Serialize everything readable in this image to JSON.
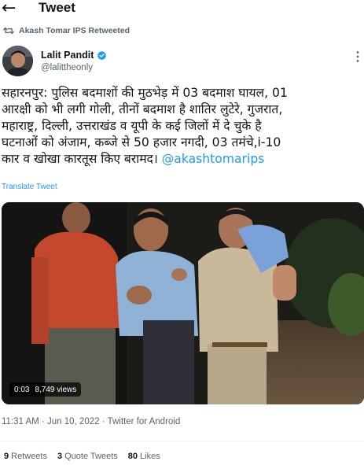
{
  "header": {
    "title": "Tweet",
    "back_icon": "back-arrow-icon"
  },
  "retweet_context": {
    "text": "Akash Tomar IPS Retweeted",
    "icon": "retweet-icon"
  },
  "author": {
    "name": "Lalit Pandit",
    "handle": "@lalittheonly",
    "verified": true,
    "verified_color": "#1d9bf0"
  },
  "tweet": {
    "lines": [
      "सहारनपुर: पुलिस बदमाशों की मुठभेड़ में 03 बदमाश घायल, 01",
      "आरक्षी को भी लगी गोली, तीनों बदमाश है शातिर लुटेरे, गुजरात,",
      "महाराष्ट्र, दिल्ली, उत्तराखंड व यूपी के कई जिलों में दे चुके है",
      "घटनाओं को अंजाम, कब्जे से 50 हजार नगदी, 03 तमंचे,i-10"
    ],
    "last_line": "कार व खोखा कारतूस किए बरामद।",
    "mention": "@akashtomarips",
    "translate_label": "Translate Tweet"
  },
  "media": {
    "type": "video",
    "duration": "0:03",
    "views": "8,749 views"
  },
  "meta": {
    "time": "11:31 AM",
    "separator": "·",
    "date": "Jun 10, 2022",
    "source": "Twitter for Android"
  },
  "stats": {
    "retweets_count": "9",
    "retweets_label": "Retweets",
    "quotes_count": "3",
    "quotes_label": "Quote Tweets",
    "likes_count": "80",
    "likes_label": "Likes"
  },
  "colors": {
    "accent": "#1d9bf0",
    "secondary_text": "#536471",
    "primary_text": "#0f1419"
  }
}
